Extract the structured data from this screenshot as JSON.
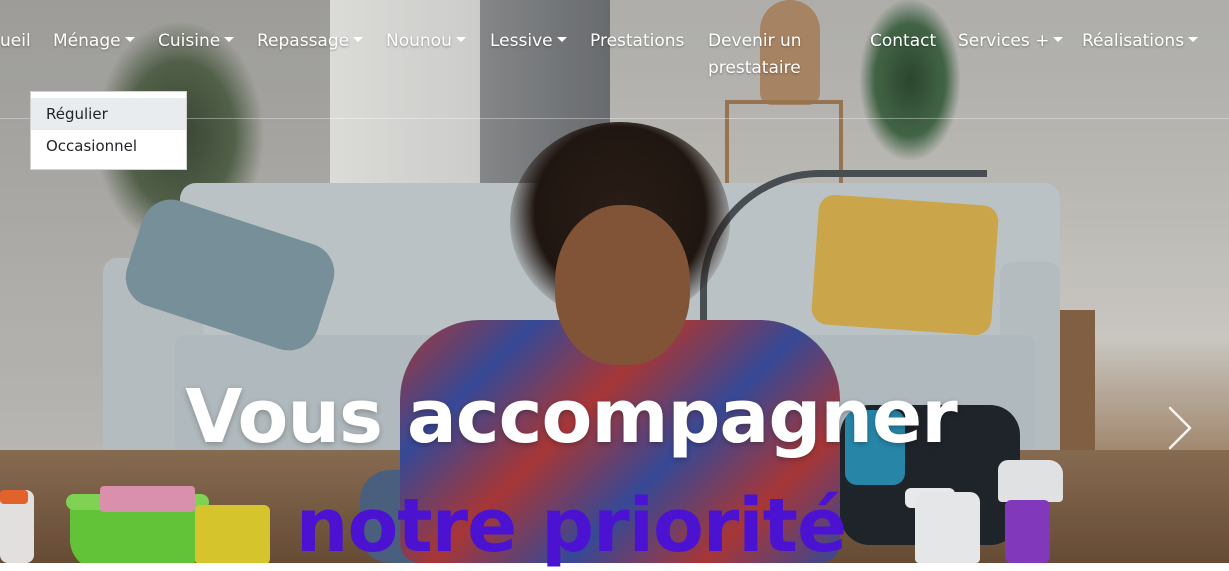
{
  "nav": {
    "items": [
      {
        "label": "ueil",
        "has_caret": false
      },
      {
        "label": "Ménage",
        "has_caret": true
      },
      {
        "label": "Cuisine",
        "has_caret": true
      },
      {
        "label": "Repassage",
        "has_caret": true
      },
      {
        "label": "Nounou",
        "has_caret": true
      },
      {
        "label": "Lessive",
        "has_caret": true
      },
      {
        "label": "Prestations",
        "has_caret": false
      },
      {
        "label": "Devenir un prestataire",
        "has_caret": false
      },
      {
        "label": "Contact",
        "has_caret": false
      },
      {
        "label": "Services +",
        "has_caret": true
      },
      {
        "label": "Réalisations",
        "has_caret": true
      }
    ]
  },
  "dropdown": {
    "items": [
      {
        "label": "Régulier",
        "active": true
      },
      {
        "label": "Occasionnel",
        "active": false
      }
    ]
  },
  "hero": {
    "title": "Vous accompagner",
    "subtitle": "notre priorité",
    "subtitle_color": "#4b12d2"
  },
  "carousel": {
    "next_icon": "chevron-right-icon"
  }
}
